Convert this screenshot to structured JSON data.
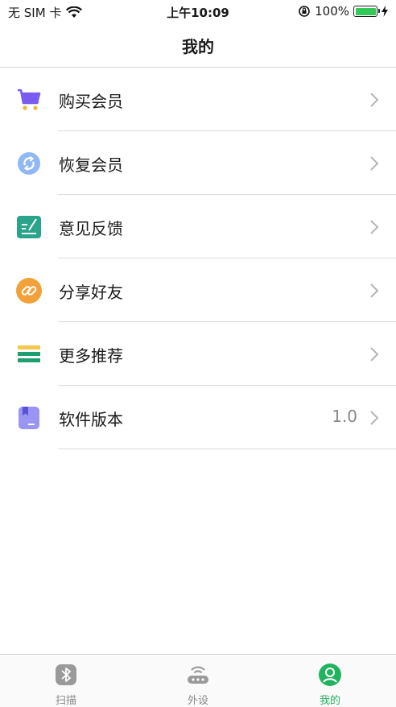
{
  "status_bar": {
    "carrier": "无 SIM 卡",
    "time": "上午10:09",
    "battery_text": "100%"
  },
  "nav": {
    "title": "我的"
  },
  "menu": {
    "items": [
      {
        "label": "购买会员",
        "icon": "cart-icon",
        "value": ""
      },
      {
        "label": "恢复会员",
        "icon": "restore-icon",
        "value": ""
      },
      {
        "label": "意见反馈",
        "icon": "feedback-icon",
        "value": ""
      },
      {
        "label": "分享好友",
        "icon": "share-link-icon",
        "value": ""
      },
      {
        "label": "更多推荐",
        "icon": "more-recommend-icon",
        "value": ""
      },
      {
        "label": "软件版本",
        "icon": "version-icon",
        "value": "1.0"
      }
    ]
  },
  "tab_bar": {
    "tabs": [
      {
        "label": "扫描",
        "icon": "bluetooth-icon",
        "active": false
      },
      {
        "label": "外设",
        "icon": "router-icon",
        "active": false
      },
      {
        "label": "我的",
        "icon": "profile-icon",
        "active": true
      }
    ]
  },
  "colors": {
    "accent": "#22b35e",
    "divider": "#dcdcdc",
    "cart_purple": "#7b5cf0",
    "restore_blue": "#5b9bf0",
    "feedback_teal": "#2aa58b",
    "share_orange": "#f2a13a",
    "version_purple": "#8c86f0"
  }
}
